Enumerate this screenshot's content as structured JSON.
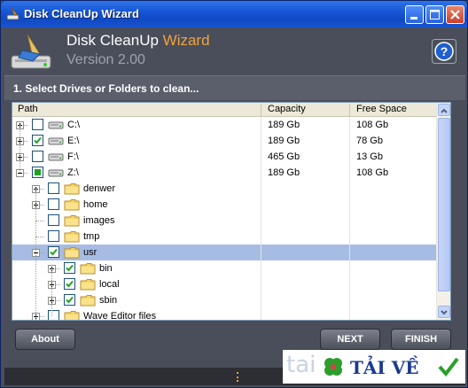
{
  "window": {
    "title": "Disk CleanUp Wizard"
  },
  "header": {
    "name_main": "Disk CleanUp ",
    "name_accent": "Wizard",
    "version": "Version 2.00"
  },
  "step": {
    "label": "1. Select Drives or Folders to clean..."
  },
  "columns": {
    "path": "Path",
    "capacity": "Capacity",
    "free": "Free Space"
  },
  "rows": [
    {
      "label": "C:\\",
      "capacity": "189 Gb",
      "free": "108 Gb",
      "checked": "none"
    },
    {
      "label": "E:\\",
      "capacity": "189 Gb",
      "free": "78 Gb",
      "checked": "full"
    },
    {
      "label": "F:\\",
      "capacity": "465 Gb",
      "free": "13 Gb",
      "checked": "none"
    },
    {
      "label": "Z:\\",
      "capacity": "189 Gb",
      "free": "108 Gb",
      "checked": "partial"
    },
    {
      "label": "denwer",
      "checked": "none"
    },
    {
      "label": "home",
      "checked": "none"
    },
    {
      "label": "images",
      "checked": "none"
    },
    {
      "label": "tmp",
      "checked": "none"
    },
    {
      "label": "usr",
      "checked": "full"
    },
    {
      "label": "bin",
      "checked": "full"
    },
    {
      "label": "local",
      "checked": "full"
    },
    {
      "label": "sbin",
      "checked": "full"
    },
    {
      "label": "Wave Editor files",
      "checked": "none"
    }
  ],
  "buttons": {
    "about": "About",
    "next": "NEXT",
    "finish": "FINISH"
  },
  "watermark": {
    "tai": "tai",
    "brand": "TẢI VỀ"
  },
  "colors": {
    "accent": "#f2a33a",
    "selection": "#a7bce3",
    "check": "#21a121"
  }
}
